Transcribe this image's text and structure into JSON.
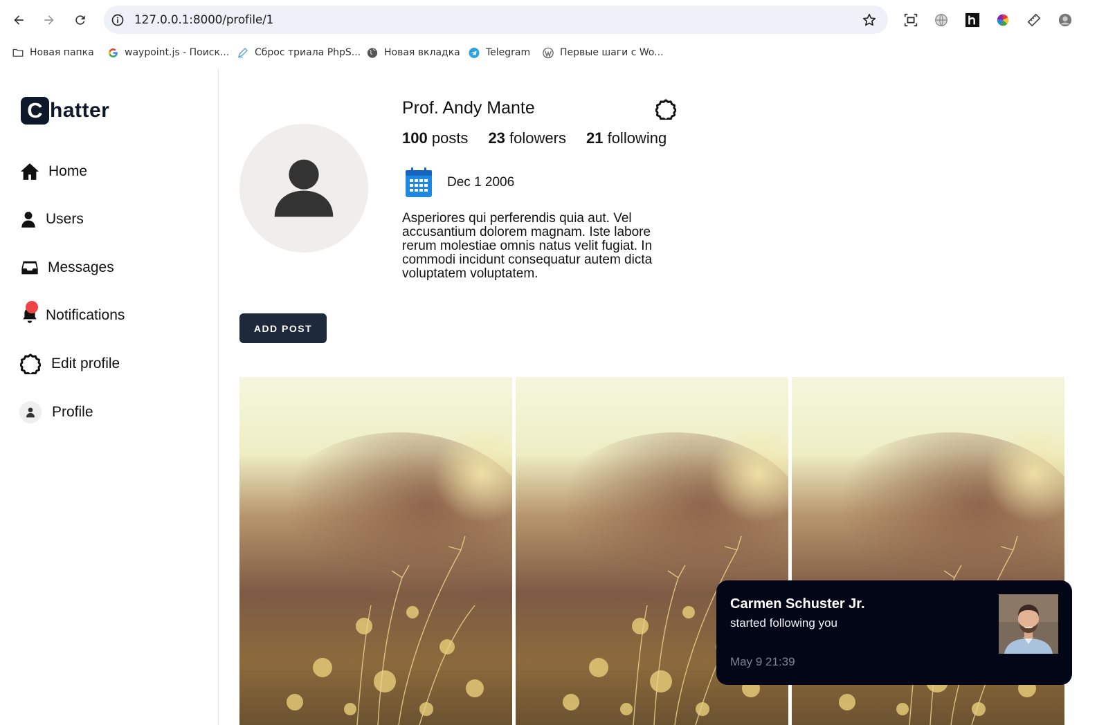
{
  "browser": {
    "url": "127.0.0.1:8000/profile/1",
    "bookmarks": [
      {
        "label": "Новая папка",
        "icon": "folder-icon"
      },
      {
        "label": "waypoint.js - Поиск...",
        "icon": "google-icon"
      },
      {
        "label": "Сброс триала PhpS...",
        "icon": "pen-icon"
      },
      {
        "label": "Новая вкладка",
        "icon": "globe-icon"
      },
      {
        "label": "Telegram",
        "icon": "telegram-icon"
      },
      {
        "label": "Первые шаги с Wo...",
        "icon": "wordpress-icon"
      }
    ]
  },
  "app": {
    "brand_letter": "C",
    "brand_rest": "hatter",
    "menu": [
      {
        "label": "Home",
        "icon": "home-icon"
      },
      {
        "label": "Users",
        "icon": "user-icon"
      },
      {
        "label": "Messages",
        "icon": "inbox-icon"
      },
      {
        "label": "Notifications",
        "icon": "bell-icon"
      },
      {
        "label": "Edit profile",
        "icon": "gear-icon"
      },
      {
        "label": "Profile",
        "icon": "avatar-icon"
      }
    ]
  },
  "profile": {
    "name": "Prof. Andy Mante",
    "stats": {
      "posts_count": "100",
      "posts_label": "posts",
      "followers_count": "23",
      "followers_label": "folowers",
      "following_count": "21",
      "following_label": "following"
    },
    "joined": "Dec 1 2006",
    "bio": "Asperiores qui perferendis quia aut. Vel accusantium dolorem magnam. Iste labore rerum molestiae omnis natus velit fugiat. In commodi incidunt consequatur autem dicta voluptatem voluptatem.",
    "add_post_label": "ADD POST"
  },
  "toast": {
    "name": "Carmen Schuster Jr.",
    "message": "started following you",
    "time": "May 9 21:39"
  },
  "colors": {
    "brand": "#0f172a",
    "button": "#1e293b",
    "notification_dot": "#ef4444",
    "toast_bg": "#020617",
    "calendar": "#1e88e5"
  }
}
